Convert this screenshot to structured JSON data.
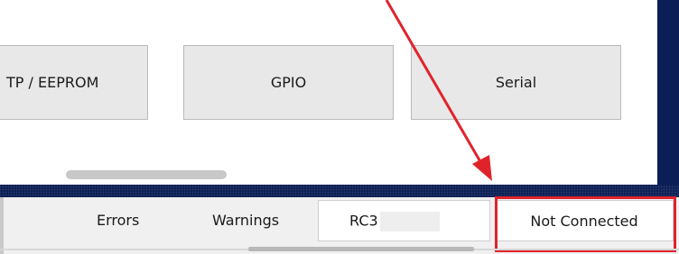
{
  "toolbar": {
    "buttons": [
      {
        "label": "TP / EEPROM"
      },
      {
        "label": "GPIO"
      },
      {
        "label": "Serial"
      }
    ]
  },
  "statusbar": {
    "errors_label": "Errors",
    "warnings_label": "Warnings",
    "rc_field_value": "RC3",
    "connection_status": "Not Connected"
  },
  "annotation": {
    "arrow_color": "#e0232b",
    "highlight_color": "#e0232b"
  },
  "colors": {
    "panel_dark_blue": "#0b1e55",
    "button_bg": "#e8e8e8",
    "statusbar_bg": "#f0f0f0"
  }
}
